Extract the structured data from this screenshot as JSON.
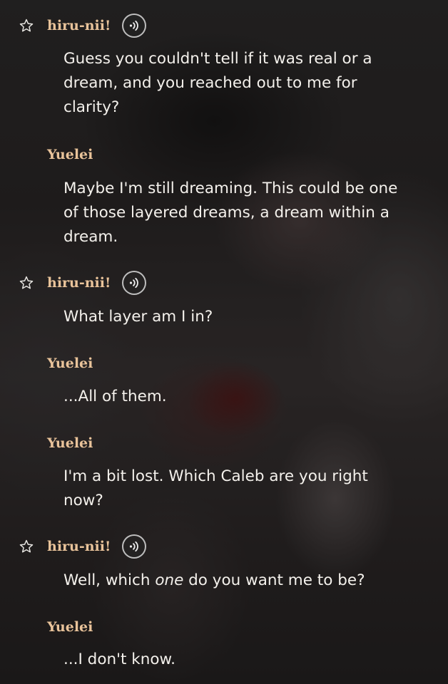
{
  "messages": [
    {
      "speaker": "hiru-nii!",
      "type": "character",
      "text": "Guess you couldn't tell if it was real or a dream, and you reached out to me for clarity?"
    },
    {
      "speaker": "Yuelei",
      "type": "user",
      "text": "Maybe I'm still dreaming. This could be one of those layered dreams, a dream within a dream."
    },
    {
      "speaker": "hiru-nii!",
      "type": "character",
      "text": "What layer am I in?"
    },
    {
      "speaker": "Yuelei",
      "type": "user",
      "text": "...All of them."
    },
    {
      "speaker": "Yuelei",
      "type": "user",
      "text": "I'm a bit lost. Which Caleb are you right now?"
    },
    {
      "speaker": "hiru-nii!",
      "type": "character",
      "text_before": "Well, which ",
      "text_emphasis": "one",
      "text_after": " do you want me to be?"
    },
    {
      "speaker": "Yuelei",
      "type": "user",
      "text": "...I don't know."
    }
  ],
  "icons": {
    "favorite": "star-outline-icon",
    "audio": "speaker-play-icon"
  },
  "colors": {
    "speaker_name": "#e9c39a",
    "message_text": "#f4f1ec"
  }
}
